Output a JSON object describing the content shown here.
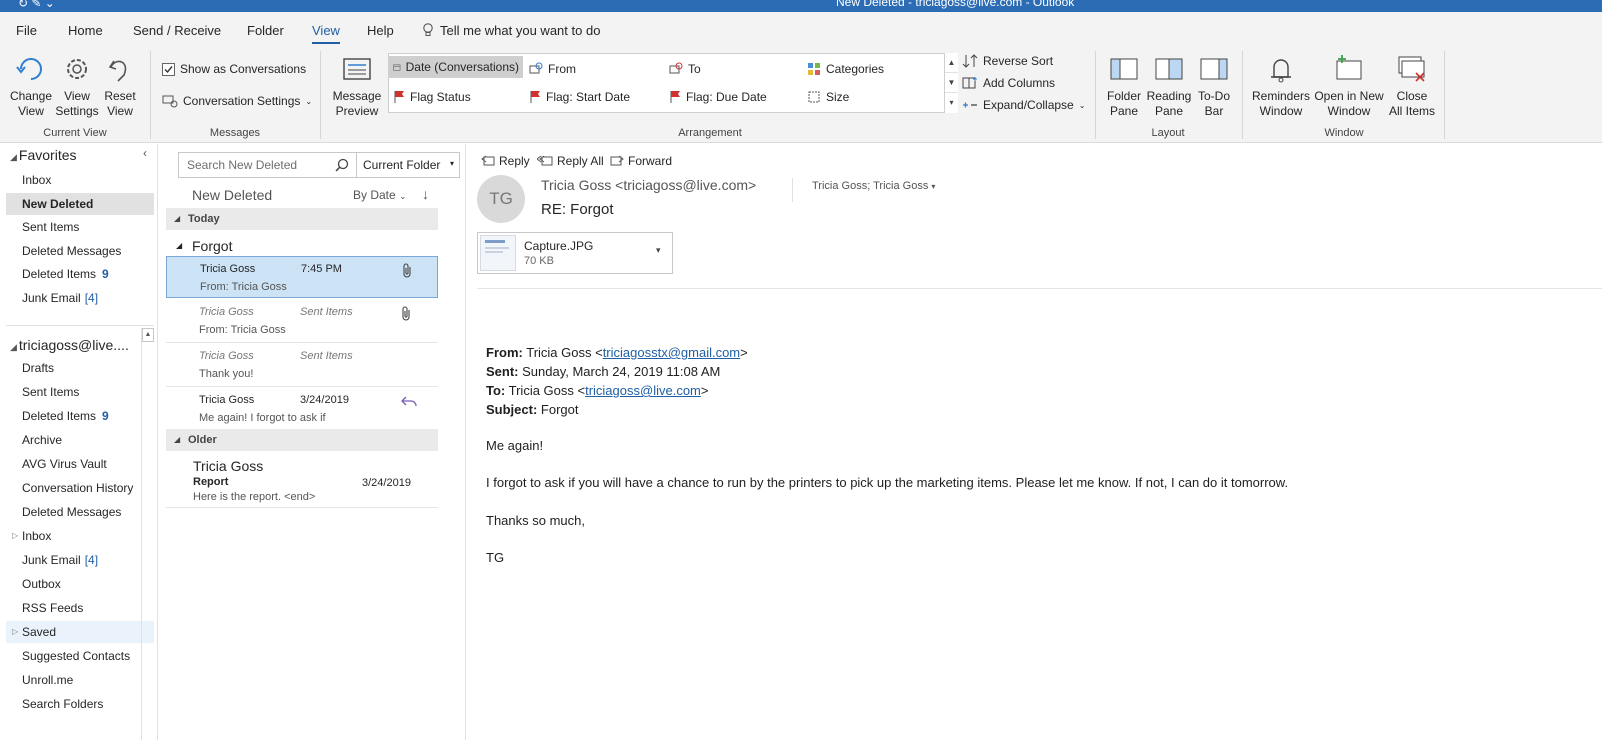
{
  "title_bar": {
    "text": "New Deleted - triciagoss@live.com - Outlook"
  },
  "menu": [
    "File",
    "Home",
    "Send / Receive",
    "Folder",
    "View",
    "Help"
  ],
  "tell_me": "Tell me what you want to do",
  "ribbon": {
    "current_view": {
      "change_view": "Change\nView",
      "view_settings": "View\nSettings",
      "reset_view": "Reset\nView",
      "label": "Current View"
    },
    "messages": {
      "show_as_conversations": "Show as Conversations",
      "conversation_settings": "Conversation Settings",
      "label": "Messages"
    },
    "arrangement": {
      "message_preview": "Message\nPreview",
      "items": [
        "Date (Conversations)",
        "From",
        "To",
        "Categories",
        "Flag Status",
        "Flag: Start Date",
        "Flag: Due Date",
        "Size"
      ],
      "reverse_sort": "Reverse Sort",
      "add_columns": "Add Columns",
      "expand_collapse": "Expand/Collapse",
      "label": "Arrangement"
    },
    "layout": {
      "folder_pane": "Folder\nPane",
      "reading_pane": "Reading\nPane",
      "todo_bar": "To-Do\nBar",
      "label": "Layout"
    },
    "window": {
      "reminders": "Reminders\nWindow",
      "open_new": "Open in New\nWindow",
      "close_all": "Close\nAll Items",
      "label": "Window"
    }
  },
  "folder_pane": {
    "favorites_header": "Favorites",
    "favorites": [
      {
        "name": "Inbox"
      },
      {
        "name": "New Deleted",
        "selected": true
      },
      {
        "name": "Sent Items"
      },
      {
        "name": "Deleted Messages"
      },
      {
        "name": "Deleted Items",
        "count": "9"
      },
      {
        "name": "Junk Email",
        "bracket": "[4]"
      }
    ],
    "account_header": "triciagoss@live....",
    "account_folders": [
      {
        "name": "Drafts"
      },
      {
        "name": "Sent Items"
      },
      {
        "name": "Deleted Items",
        "count": "9"
      },
      {
        "name": "Archive"
      },
      {
        "name": "AVG Virus Vault"
      },
      {
        "name": "Conversation History"
      },
      {
        "name": "Deleted Messages"
      },
      {
        "name": "Inbox",
        "expandable": true
      },
      {
        "name": "Junk Email",
        "bracket": "[4]"
      },
      {
        "name": "Outbox"
      },
      {
        "name": "RSS Feeds"
      },
      {
        "name": "Saved",
        "expandable": true,
        "hover": true
      },
      {
        "name": "Suggested Contacts"
      },
      {
        "name": "Unroll.me"
      },
      {
        "name": "Search Folders"
      }
    ]
  },
  "message_list": {
    "search_placeholder": "Search New Deleted",
    "search_scope": "Current Folder",
    "folder_title": "New Deleted",
    "sort": "By Date",
    "groups": {
      "today": "Today",
      "older": "Older"
    },
    "conversation": "Forgot",
    "messages": [
      {
        "sender": "Tricia Goss",
        "when": "7:45 PM",
        "preview": "From: Tricia Goss",
        "attachment": true,
        "selected": true
      },
      {
        "sender": "Tricia Goss",
        "when": "Sent Items",
        "preview": "From: Tricia Goss",
        "attachment": true,
        "italic": true
      },
      {
        "sender": "Tricia Goss",
        "when": "Sent Items",
        "preview": "Thank you!",
        "italic": true
      },
      {
        "sender": "Tricia Goss",
        "when": "3/24/2019",
        "preview": "Me again!  I forgot to ask if",
        "replied": true
      }
    ],
    "older_message": {
      "sender": "Tricia Goss",
      "subject": "Report",
      "preview": "Here is the report. <end>",
      "date": "3/24/2019"
    }
  },
  "reading_pane": {
    "actions": [
      "Reply",
      "Reply All",
      "Forward"
    ],
    "avatar": "TG",
    "from": "Tricia Goss <triciagoss@live.com>",
    "to": "Tricia Goss; Tricia Goss",
    "subject": "RE: Forgot",
    "attachment": {
      "name": "Capture.JPG",
      "size": "70 KB"
    },
    "header_lines": {
      "from_label": "From:",
      "from_name": "Tricia Goss <",
      "from_email": "triciagosstx@gmail.com",
      "from_end": ">",
      "sent_label": "Sent:",
      "sent_value": "Sunday, March 24, 2019 11:08 AM",
      "to_label": "To:",
      "to_name": "Tricia Goss <",
      "to_email": "triciagoss@live.com",
      "to_end": ">",
      "subject_label": "Subject:",
      "subject_value": "Forgot"
    },
    "body": [
      "Me again!",
      "I forgot to ask if you will have a chance to run by the printers to pick up the marketing items. Please let me know. If not, I can do it tomorrow.",
      "Thanks so much,",
      "TG"
    ]
  },
  "colors": {
    "accent": "#1f5fa5",
    "titlebar": "#2b6cb5",
    "selection": "#cce3f6"
  }
}
